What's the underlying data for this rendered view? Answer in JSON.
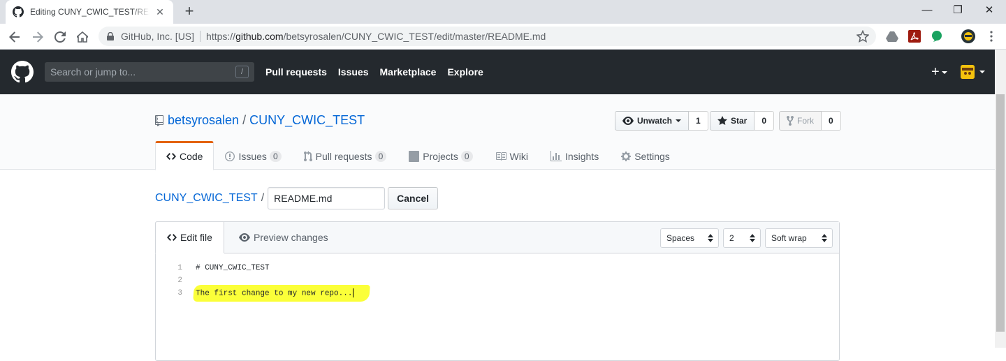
{
  "browser": {
    "tab_title": "Editing CUNY_CWIC_TEST/README.md",
    "close_glyph": "✕",
    "new_tab_glyph": "+",
    "minimize_glyph": "—",
    "restore_glyph": "❐",
    "window_close_glyph": "✕",
    "site_identity": "GitHub, Inc. [US]",
    "url_prefix": "https://",
    "url_host": "github.com",
    "url_path": "/betsyrosalen/CUNY_CWIC_TEST/edit/master/README.md"
  },
  "header": {
    "search_placeholder": "Search or jump to...",
    "search_shortcut": "/",
    "nav": [
      "Pull requests",
      "Issues",
      "Marketplace",
      "Explore"
    ],
    "plus_glyph": "+"
  },
  "repo": {
    "owner": "betsyrosalen",
    "name": "CUNY_CWIC_TEST",
    "separator": "/",
    "unwatch_label": "Unwatch",
    "watch_count": "1",
    "star_label": "Star",
    "star_count": "0",
    "fork_label": "Fork",
    "fork_count": "0",
    "tabs": {
      "code": "Code",
      "issues": "Issues",
      "issues_count": "0",
      "pulls": "Pull requests",
      "pulls_count": "0",
      "projects": "Projects",
      "projects_count": "0",
      "wiki": "Wiki",
      "insights": "Insights",
      "settings": "Settings"
    }
  },
  "edit": {
    "breadcrumb_repo": "CUNY_CWIC_TEST",
    "breadcrumb_sep": "/",
    "filename": "README.md",
    "cancel_label": "Cancel",
    "tab_edit": "Edit file",
    "tab_preview": "Preview changes",
    "indent_mode": "Spaces",
    "indent_size": "2",
    "wrap_mode": "Soft wrap",
    "lines": [
      {
        "num": "1",
        "text": "# CUNY_CWIC_TEST"
      },
      {
        "num": "2",
        "text": ""
      },
      {
        "num": "3",
        "text": "The first change to my new repo..."
      }
    ],
    "highlight_color": "#fbff2e"
  }
}
